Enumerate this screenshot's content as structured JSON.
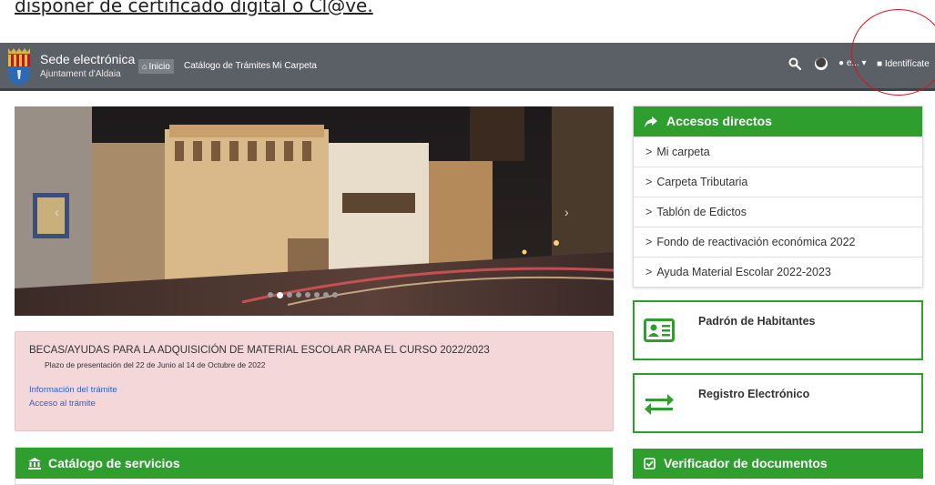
{
  "top_text": "disponer de certificado digital o Cl@ve.",
  "navbar": {
    "title": "Sede electrónica",
    "subtitle": "Ajuntament d'Aldaia",
    "items": [
      {
        "label": "Inicio",
        "active": true,
        "icon": "home-icon"
      },
      {
        "label": "Catálogo de Trámites",
        "active": false
      },
      {
        "label": "Mi Carpeta",
        "active": false
      }
    ],
    "lang_label": "e...",
    "user_label": "Identifícate",
    "colors": {
      "bar": "#5b5f66",
      "accent_green": "#2e9e2e",
      "highlight_circle": "#e01020"
    }
  },
  "carousel": {
    "prev_icon": "chevron-left-icon",
    "next_icon": "chevron-right-icon",
    "slide_count": 8,
    "active_index": 1
  },
  "notice": {
    "title": "BECAS/AYUDAS PARA LA ADQUISICIÓN DE MATERIAL ESCOLAR PARA EL CURSO 2022/2023",
    "subtitle": "Plazo de presentación del 22 de Junio al 14 de Octubre de 2022",
    "link_info": "Información del trámite",
    "link_access": "Acceso al trámite"
  },
  "catalogo": {
    "title": "Catálogo de servicios",
    "icon": "bank-icon"
  },
  "accesos": {
    "title": "Accesos directos",
    "icon": "share-icon",
    "items": [
      "Mi carpeta",
      "Carpeta Tributaria",
      "Tablón de Edictos",
      "Fondo de reactivación económica 2022",
      "Ayuda Material Escolar 2022-2023"
    ]
  },
  "tiles": {
    "padron": {
      "label": "Padrón de Habitantes",
      "icon": "id-card-icon"
    },
    "registro": {
      "label": "Registro Electrónico",
      "icon": "exchange-arrows-icon"
    }
  },
  "verificador": {
    "title": "Verificador de documentos",
    "icon": "check-square-icon"
  }
}
